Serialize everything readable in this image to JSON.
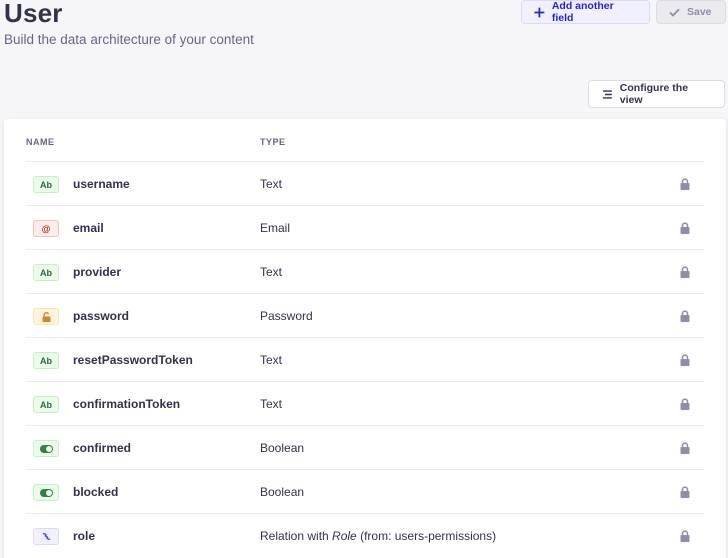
{
  "header": {
    "title": "User",
    "subtitle": "Build the data architecture of your content"
  },
  "actions": {
    "add_label": "Add another field",
    "save_label": "Save",
    "configure_label": "Configure the view"
  },
  "table": {
    "col_name": "NAME",
    "col_type": "TYPE",
    "rows": [
      {
        "badge": "Ab",
        "icon": "text-icon",
        "name": "username",
        "type": "Text"
      },
      {
        "badge": "@",
        "icon": "email-icon",
        "name": "email",
        "type": "Email"
      },
      {
        "badge": "Ab",
        "icon": "text-icon",
        "name": "provider",
        "type": "Text"
      },
      {
        "badge": "",
        "icon": "password-lock-icon",
        "name": "password",
        "type": "Password"
      },
      {
        "badge": "Ab",
        "icon": "text-icon",
        "name": "resetPasswordToken",
        "type": "Text"
      },
      {
        "badge": "Ab",
        "icon": "text-icon",
        "name": "confirmationToken",
        "type": "Text"
      },
      {
        "badge": "",
        "icon": "toggle-icon",
        "name": "confirmed",
        "type": "Boolean"
      },
      {
        "badge": "",
        "icon": "toggle-icon",
        "name": "blocked",
        "type": "Boolean"
      },
      {
        "badge": "",
        "icon": "relation-icon",
        "name": "role",
        "type_prefix": "Relation with ",
        "type_target": "Role",
        "type_suffix": " (from: users-permissions)"
      }
    ]
  },
  "colors": {
    "primary": "#4945ff",
    "text": "#32324d",
    "muted": "#666687",
    "lock": "#8e8ea9"
  }
}
